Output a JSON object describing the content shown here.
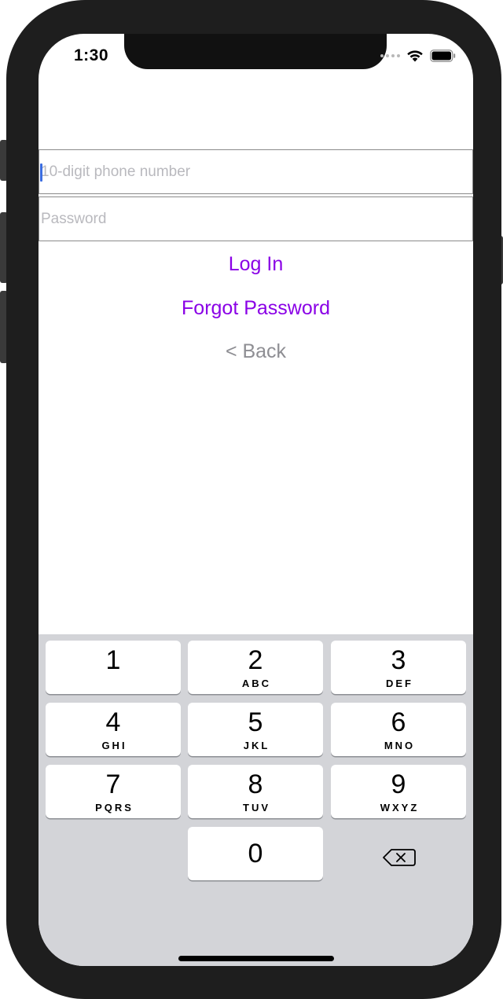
{
  "status_bar": {
    "time": "1:30"
  },
  "login_form": {
    "phone_placeholder": "10-digit phone number",
    "phone_value": "",
    "password_placeholder": "Password",
    "password_value": "",
    "login_label": "Log In",
    "forgot_label": "Forgot Password",
    "back_label": "< Back"
  },
  "colors": {
    "accent": "#8a00e6",
    "back_text": "#8e8e93",
    "placeholder": "#b9b9be",
    "keyboard_bg": "#d3d4d8",
    "cursor": "#3b6de0"
  },
  "keypad": {
    "keys": [
      {
        "digit": "1",
        "letters": ""
      },
      {
        "digit": "2",
        "letters": "ABC"
      },
      {
        "digit": "3",
        "letters": "DEF"
      },
      {
        "digit": "4",
        "letters": "GHI"
      },
      {
        "digit": "5",
        "letters": "JKL"
      },
      {
        "digit": "6",
        "letters": "MNO"
      },
      {
        "digit": "7",
        "letters": "PQRS"
      },
      {
        "digit": "8",
        "letters": "TUV"
      },
      {
        "digit": "9",
        "letters": "WXYZ"
      },
      {
        "digit": "0",
        "letters": ""
      }
    ],
    "backspace_icon": "delete-left-icon"
  },
  "icons": {
    "signal": "signal-dots-icon",
    "wifi": "wifi-icon",
    "battery": "battery-icon"
  }
}
